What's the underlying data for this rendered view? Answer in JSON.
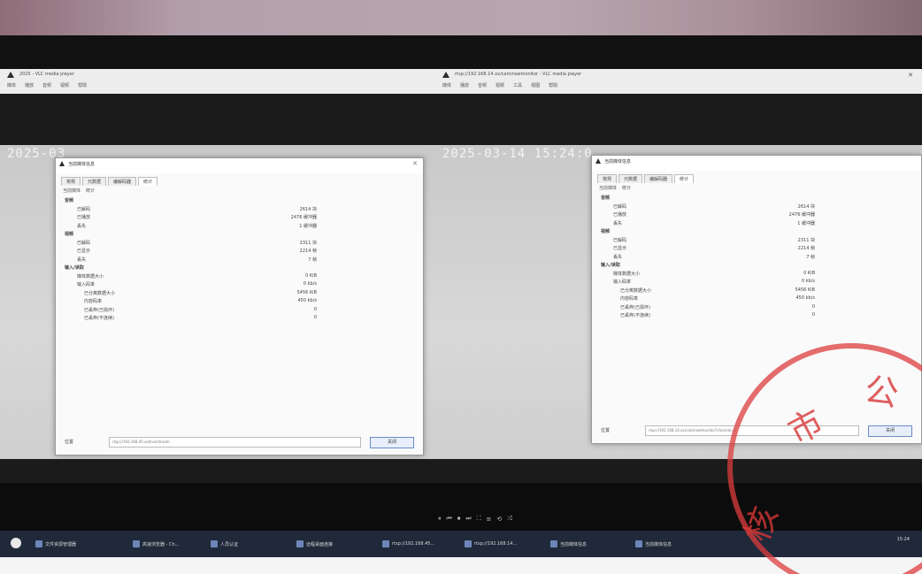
{
  "left_window": {
    "title": "2025 - VLC media player",
    "menu": [
      "媒体",
      "播放",
      "音频",
      "视频",
      "帮助"
    ],
    "timestamp": "2025-03",
    "dialog": {
      "title": "当前媒体信息",
      "tabs": [
        "常规",
        "元数据",
        "编解码器",
        "统计"
      ],
      "subtabs": [
        "当前媒体",
        "统计"
      ],
      "codec_label": "位置",
      "codec_value": "rtsp://192.168.45.xx/live/stream",
      "close_label": "关闭"
    }
  },
  "right_window": {
    "title": "rtsp://192.168.14.xx/cam/realmonitor - VLC media player",
    "menu": [
      "媒体",
      "播放",
      "音频",
      "视频",
      "工具",
      "视图",
      "帮助"
    ],
    "timestamp": "2025-03-14 15:24:0",
    "dialog": {
      "title": "当前媒体信息",
      "tabs": [
        "常规",
        "元数据",
        "编解码器",
        "统计"
      ],
      "subtabs": [
        "当前媒体",
        "统计"
      ],
      "codec_label": "位置",
      "codec_value": "rtsp://192.168.14.xx/cam/realmonitor?channel=1",
      "close_label": "关闭"
    }
  },
  "stats_rows": [
    {
      "level": "sec",
      "key": "音频"
    },
    {
      "level": "l1",
      "key": "已解码",
      "value": "2614 块"
    },
    {
      "level": "l1",
      "key": "已播放",
      "value": "2476 缓冲器"
    },
    {
      "level": "l1",
      "key": "丢失",
      "value": "1 缓冲器"
    },
    {
      "level": "sec",
      "key": "视频"
    },
    {
      "level": "l1",
      "key": "已解码",
      "value": "2311 块"
    },
    {
      "level": "l1",
      "key": "已显示",
      "value": "2214 帧"
    },
    {
      "level": "l1",
      "key": "丢失",
      "value": "7 帧"
    },
    {
      "level": "sec",
      "key": "输入/读取"
    },
    {
      "level": "l1",
      "key": "媒体数据大小",
      "value": "0 KiB"
    },
    {
      "level": "l1",
      "key": "输入码率",
      "value": "0 kb/s"
    },
    {
      "level": "l2",
      "key": "已分离数据大小",
      "value": "5456 KiB"
    },
    {
      "level": "l2",
      "key": "内容码率",
      "value": "450 kb/s"
    },
    {
      "level": "l2",
      "key": "已丢弃(已损坏)",
      "value": "0"
    },
    {
      "level": "l2",
      "key": "已丢弃(不连续)",
      "value": "0"
    }
  ],
  "controls": [
    "⏸",
    "⏮",
    "⏹",
    "⏭",
    "⛶",
    "≡",
    "⟲",
    "⤮"
  ],
  "taskbar": {
    "items": [
      "文件资源管理器",
      "高速浏览器 - Ch...",
      "人员认证",
      "远程桌面连接",
      "rtsp://192.168.45...",
      "rtsp://192.168.14...",
      "当前媒体信息",
      "当前媒体信息"
    ],
    "clock": "15:24"
  },
  "stamp_chars": [
    "市",
    "公",
    "核"
  ],
  "colors": {
    "stamp": "#d83a3a",
    "taskbar": "#20293a"
  }
}
